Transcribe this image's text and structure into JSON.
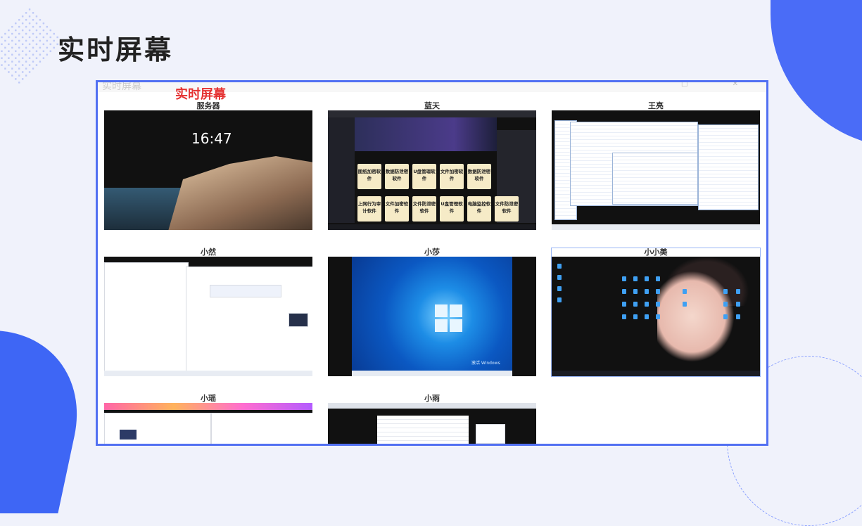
{
  "page": {
    "title": "实时屏幕"
  },
  "window": {
    "app_title": "实时屏幕",
    "header_label": "实时屏幕"
  },
  "tiles": [
    {
      "name": "服务器",
      "clock": "16:47",
      "kind": "lock-screen"
    },
    {
      "name": "蓝天",
      "kind": "dark-cards",
      "cards": [
        "图纸加密软件",
        "数据防泄密软件",
        "U盘管理软件",
        "文件加密软件",
        "数据防泄密软件",
        "上网行为审计软件",
        "文件加密软件",
        "文件防泄密软件",
        "U盘管理软件",
        "电脑监控软件",
        "文件防泄密软件"
      ]
    },
    {
      "name": "王亮",
      "kind": "explorer"
    },
    {
      "name": "小然",
      "kind": "browser"
    },
    {
      "name": "小莎",
      "kind": "windows-desktop",
      "watermark": "激活 Windows"
    },
    {
      "name": "小小美",
      "kind": "wallpaper-desktop",
      "selected": true
    },
    {
      "name": "小瑶",
      "kind": "browser"
    },
    {
      "name": "小雨",
      "kind": "document"
    }
  ],
  "colors": {
    "accent": "#4a6cf7",
    "frame_border": "#5270f2",
    "header_red": "#e53333"
  }
}
